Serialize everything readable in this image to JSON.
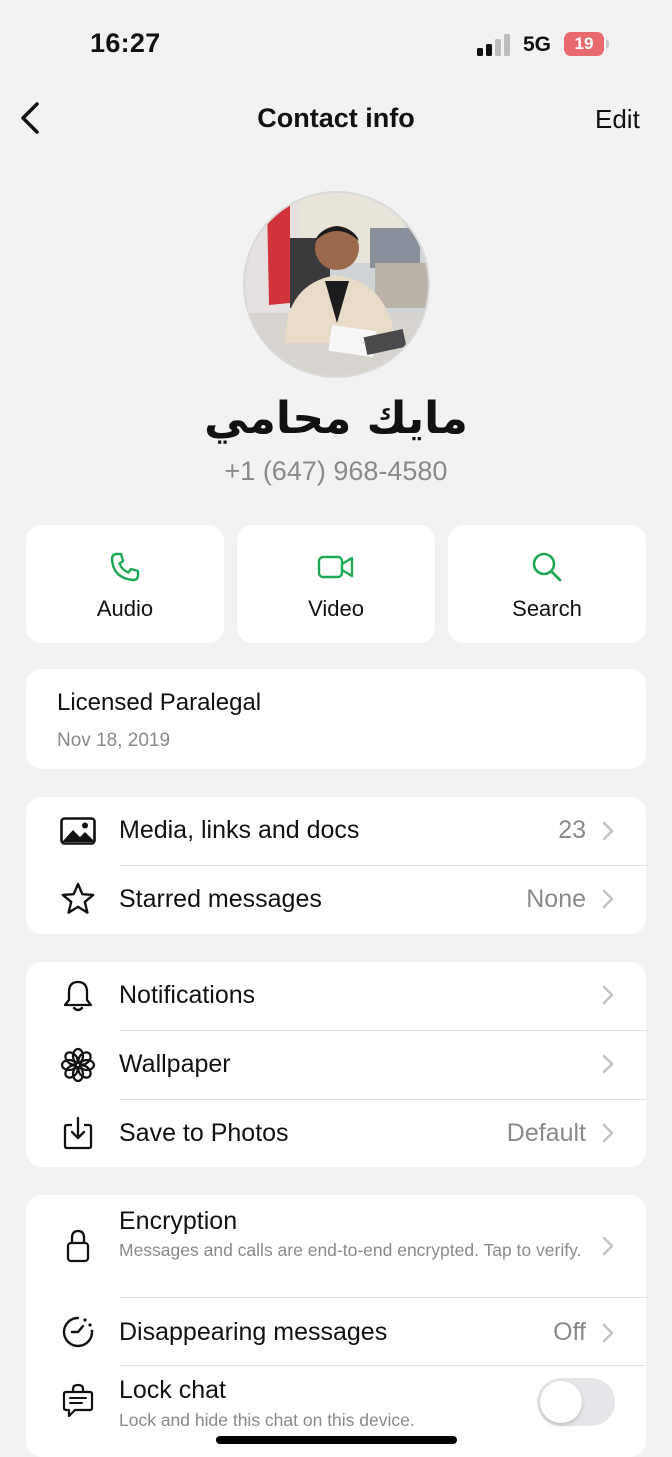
{
  "status_bar": {
    "time": "16:27",
    "network": "5G",
    "battery": "19"
  },
  "nav": {
    "back_icon": "chevron-left-icon",
    "title": "Contact info",
    "edit_label": "Edit"
  },
  "contact": {
    "name": "مايك محامي",
    "phone": "+1 (647) 968-4580"
  },
  "actions": [
    {
      "label": "Audio",
      "icon": "phone-icon"
    },
    {
      "label": "Video",
      "icon": "video-icon"
    },
    {
      "label": "Search",
      "icon": "search-icon"
    }
  ],
  "about": {
    "text": "Licensed Paralegal",
    "date": "Nov 18, 2019"
  },
  "media_section": [
    {
      "label": "Media, links and docs",
      "value": "23",
      "icon": "image-icon"
    },
    {
      "label": "Starred messages",
      "value": "None",
      "icon": "star-icon"
    }
  ],
  "settings_section": [
    {
      "label": "Notifications",
      "value": "",
      "icon": "bell-icon"
    },
    {
      "label": "Wallpaper",
      "value": "",
      "icon": "flower-icon"
    },
    {
      "label": "Save to Photos",
      "value": "Default",
      "icon": "download-icon"
    }
  ],
  "privacy_section": {
    "encryption": {
      "label": "Encryption",
      "subtitle": "Messages and calls are end-to-end encrypted. Tap to verify.",
      "icon": "lock-icon"
    },
    "disappearing": {
      "label": "Disappearing messages",
      "value": "Off",
      "icon": "timer-icon"
    },
    "lock_chat": {
      "label": "Lock chat",
      "subtitle": "Lock and hide this chat on this device.",
      "icon": "chat-lock-icon",
      "enabled": false
    }
  },
  "colors": {
    "accent_green": "#1fa855",
    "background": "#f2f2f2",
    "battery_low": "#e86a6f"
  }
}
